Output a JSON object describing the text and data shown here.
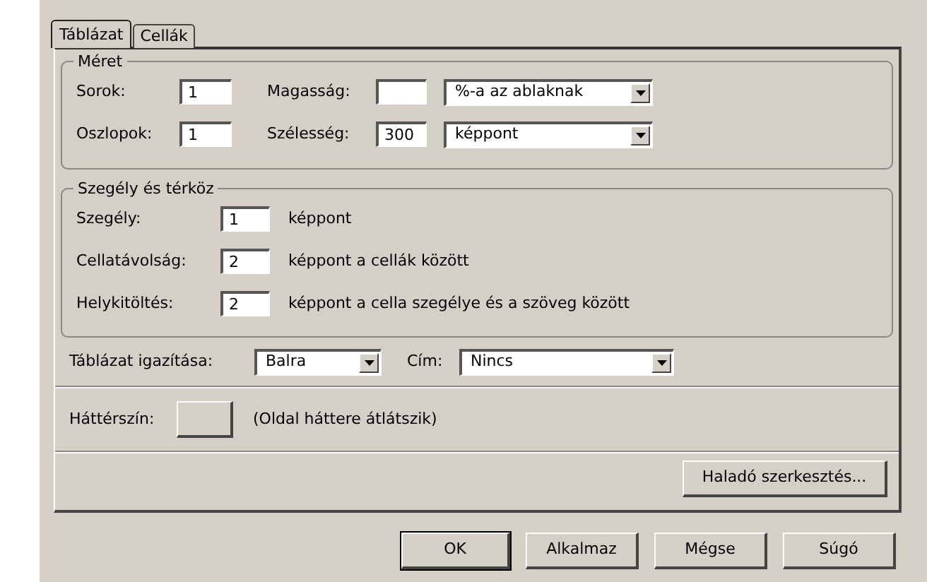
{
  "tabs": [
    {
      "label": "Táblázat",
      "selected": true
    },
    {
      "label": "Cellák",
      "selected": false
    }
  ],
  "size": {
    "legend": "Méret",
    "rows": [
      {
        "label": "Sorok:",
        "value": "1",
        "label2": "Magasság:",
        "unit": "%-a az ablaknak"
      },
      {
        "label": "Oszlopok:",
        "value": "1",
        "label2": "Szélesség:",
        "value2": "300",
        "unit": "képpont"
      }
    ]
  },
  "spacing": {
    "legend": "Szegély és térköz",
    "rows": [
      {
        "label": "Szegély:",
        "value": "1",
        "note": "képpont"
      },
      {
        "label": "Cellatávolság:",
        "value": "2",
        "note": "képpont a cellák között"
      },
      {
        "label": "Helykitöltés:",
        "value": "2",
        "note": "képpont a cella szegélye és a szöveg között"
      }
    ]
  },
  "alignment": {
    "label": "Táblázat igazítása:",
    "value": "Balra"
  },
  "caption": {
    "label": "Cím:",
    "value": "Nincs"
  },
  "background": {
    "label": "Háttérszín:",
    "note": "(Oldal háttere átlátszik)"
  },
  "advanced_button": {
    "label": "Haladó szerkesztés..."
  },
  "buttons": [
    {
      "label": "OK",
      "default": true
    },
    {
      "label": "Alkalmaz",
      "default": false
    },
    {
      "label": "Mégse",
      "default": false
    },
    {
      "label": "Súgó",
      "default": false
    }
  ]
}
